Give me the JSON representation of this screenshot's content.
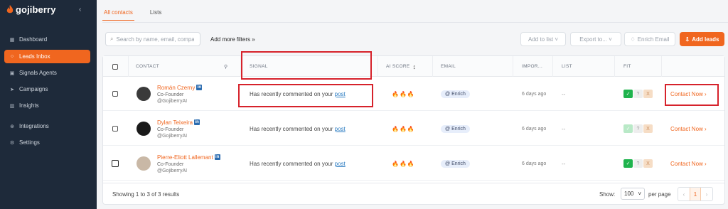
{
  "app": {
    "name": "gojiberry",
    "collapse_icon": "chevron-left-icon"
  },
  "sidebar": {
    "items": [
      {
        "label": "Dashboard",
        "icon": "grid-icon"
      },
      {
        "label": "Leads Inbox",
        "icon": "inbox-icon",
        "active": true
      },
      {
        "label": "Signals Agents",
        "icon": "robot-icon"
      },
      {
        "label": "Campaigns",
        "icon": "send-icon"
      },
      {
        "label": "Insights",
        "icon": "chart-icon"
      },
      {
        "label": "Integrations",
        "icon": "plug-icon"
      },
      {
        "label": "Settings",
        "icon": "gear-icon"
      }
    ]
  },
  "tabs": [
    {
      "label": "All contacts",
      "active": true
    },
    {
      "label": "Lists"
    }
  ],
  "toolbar": {
    "search_placeholder": "Search by name, email, company",
    "more_filters": "Add more filters »",
    "add_to_list": "Add to list ˅",
    "export": "Export to... ˅",
    "enrich_email": "Enrich Email",
    "add_leads": "Add leads"
  },
  "table": {
    "headers": {
      "contact": "CONTACT",
      "signal": "SIGNAL",
      "ai_score": "AI SCORE",
      "email": "EMAIL",
      "import": "IMPOR...",
      "list": "LIST",
      "fit": "FIT"
    },
    "rows": [
      {
        "name": "Román Czerny",
        "role": "Co-Founder",
        "company": "GojiberryAI",
        "signal_text": "Has recently commented on your",
        "signal_link": "post",
        "score": "🔥🔥🔥",
        "email": "Enrich",
        "imported": "6 days ago",
        "list": "--",
        "fit": {
          "yes": "✓",
          "q": "?",
          "x": "X"
        },
        "action": "Contact Now ›"
      },
      {
        "name": "Dylan Teixeira",
        "role": "Co-Founder",
        "company": "GojiberryAI",
        "signal_text": "Has recently commented on your",
        "signal_link": "post",
        "score": "🔥🔥🔥",
        "email": "Enrich",
        "imported": "6 days ago",
        "list": "--",
        "fit": {
          "yes": "✓",
          "q": "?",
          "x": "X"
        },
        "action": "Contact Now ›"
      },
      {
        "name": "Pierre-Eliott Lallemant",
        "role": "Co-Founder",
        "company": "GojiberryAI",
        "signal_text": "Has recently commented on your",
        "signal_link": "post",
        "score": "🔥🔥🔥",
        "email": "Enrich",
        "imported": "6 days ago",
        "list": "--",
        "fit": {
          "yes": "✓",
          "q": "?",
          "x": "X"
        },
        "action": "Contact Now ›"
      }
    ]
  },
  "footer": {
    "showing": "Showing 1 to 3 of 3 results",
    "show": "Show:",
    "per_page_value": "100",
    "per_page": "per page",
    "prev": "‹",
    "page": "1",
    "next": "›"
  },
  "colors": {
    "accent": "#f0661f",
    "sidebar": "#1e2a3a",
    "highlight": "#d6222b"
  }
}
